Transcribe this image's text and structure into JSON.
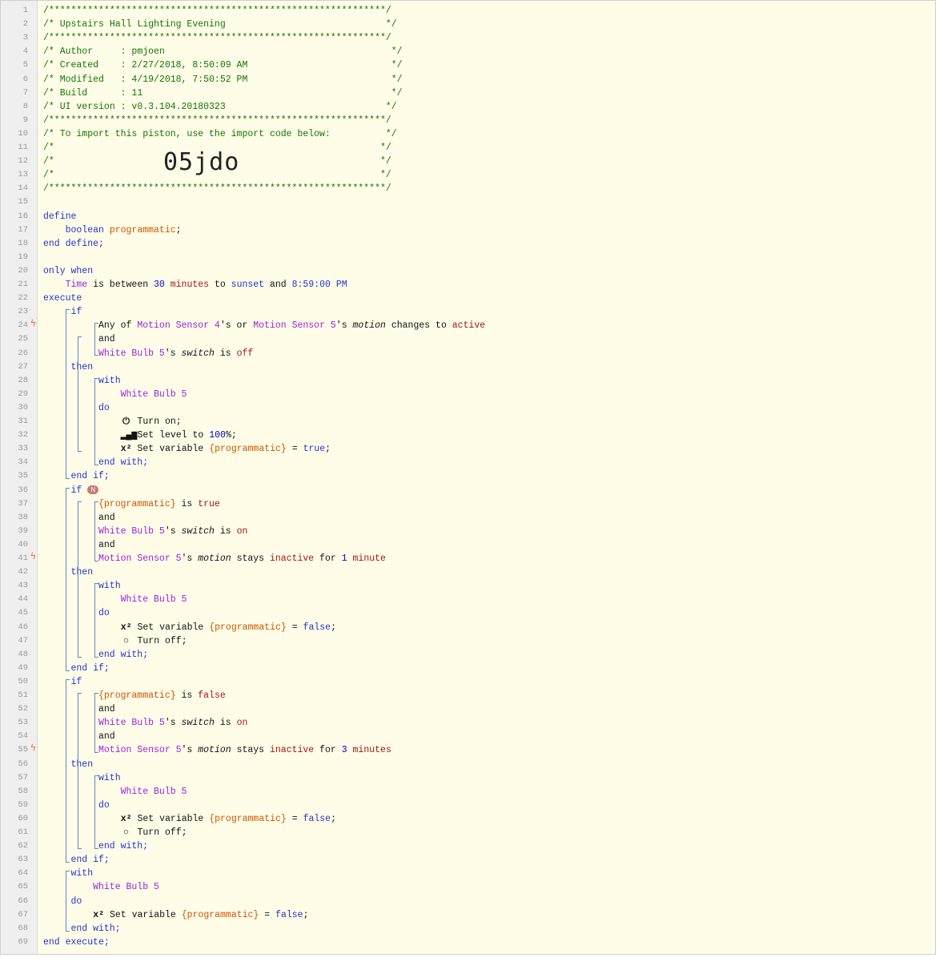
{
  "header": {
    "stars": "/*************************************************************/",
    "title_line": "/* Upstairs Hall Lighting Evening                             */",
    "author_line": "/* Author     : pmjoen                                         */",
    "created_line": "/* Created    : 2/27/2018, 8:50:09 AM                          */",
    "modified_line": "/* Modified   : 4/19/2018, 7:50:52 PM                          */",
    "build_line": "/* Build      : 11                                             */",
    "uiversion_line": "/* UI version : v0.3.104.20180323                             */",
    "import_line": "/* To import this piston, use the import code below:          */",
    "blank_comment": "/*                                                           */",
    "import_code": "05jdo"
  },
  "tokens": {
    "define": "define",
    "boolean": "boolean",
    "programmatic": "programmatic",
    "end_define": "end define;",
    "only_when": "only when",
    "time": "Time",
    "is_between": " is between ",
    "thirty": "30",
    "minutes": "minutes",
    "to": " to ",
    "sunset": "sunset",
    "and_kw": " and ",
    "time_val": "8:59:00 PM",
    "execute": "execute",
    "if": "if",
    "then": "then",
    "end_if": "end if;",
    "with": "with",
    "do": "do",
    "end_with": "end with;",
    "end_execute": "end execute;",
    "and": "and",
    "any_of": "Any of ",
    "ms4": "Motion Sensor 4",
    "ms5": "Motion Sensor 5",
    "s": "'s ",
    "or": " or ",
    "motion": "motion",
    "changes_to": " changes to ",
    "active": "active",
    "wb5": "White Bulb 5",
    "switch": "switch",
    "is": " is ",
    "off": "off",
    "on": "on",
    "turn_on": " Turn on;",
    "set_level": " Set level to ",
    "hundred": "100",
    "pct": "%;",
    "set_var": " Set variable ",
    "prog_var": "{programmatic}",
    "eq": " = ",
    "true": "true",
    "false": "false",
    "semi": ";",
    "turn_off": " Turn off;",
    "stays": " stays ",
    "inactive": "inactive",
    "for": " for ",
    "one": "1",
    "minute": "minute",
    "three": "3",
    "badge": "N",
    "icon_power": "⏻",
    "icon_level": "▂▄▆",
    "icon_var": "x²",
    "icon_off": "○"
  },
  "line_numbers": [
    "1",
    "2",
    "3",
    "4",
    "5",
    "6",
    "7",
    "8",
    "9",
    "10",
    "11",
    "12",
    "13",
    "14",
    "15",
    "16",
    "17",
    "18",
    "19",
    "20",
    "21",
    "22",
    "23",
    "24",
    "25",
    "26",
    "27",
    "28",
    "29",
    "30",
    "31",
    "32",
    "33",
    "34",
    "35",
    "36",
    "37",
    "38",
    "39",
    "40",
    "41",
    "42",
    "43",
    "44",
    "45",
    "46",
    "47",
    "48",
    "49",
    "50",
    "51",
    "52",
    "53",
    "54",
    "55",
    "56",
    "57",
    "58",
    "59",
    "60",
    "61",
    "62",
    "63",
    "64",
    "65",
    "66",
    "67",
    "68",
    "69"
  ],
  "trigger_flag": "ϟ",
  "colors": {
    "comment": "#117700",
    "keyword": "#2233cc",
    "device": "#9922dd",
    "variable": "#cc5500",
    "value": "#a31515",
    "number": "#0000cc"
  }
}
